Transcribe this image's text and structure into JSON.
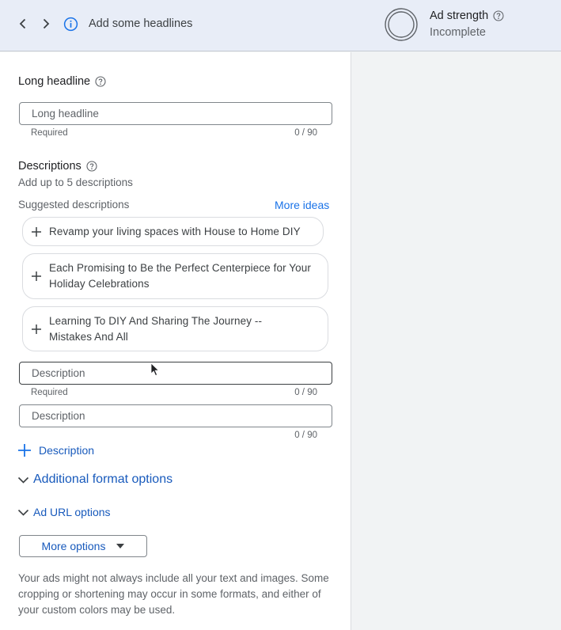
{
  "topbar": {
    "title": "Add some headlines",
    "back_icon": "chevron-left-icon",
    "forward_icon": "chevron-right-icon",
    "info_icon": "info-icon",
    "ad_strength_label": "Ad strength",
    "ad_strength_status": "Incomplete",
    "ring_color": "#5f6368"
  },
  "long_headline": {
    "label": "Long headline",
    "placeholder": "Long headline",
    "value": "",
    "hint": "Required",
    "count": "0 / 90"
  },
  "descriptions": {
    "label": "Descriptions",
    "subtitle": "Add up to 5 descriptions",
    "suggested_label": "Suggested descriptions",
    "more_ideas": "More ideas",
    "suggestions": [
      "Revamp your living spaces with House to Home DIY",
      "Each Promising to Be the Perfect Centerpiece for Your Holiday Celebrations",
      "Learning To DIY And Sharing The Journey -- Mistakes And All"
    ],
    "fields": [
      {
        "placeholder": "Description",
        "value": "",
        "hint": "Required",
        "count": "0 / 90"
      },
      {
        "placeholder": "Description",
        "value": "",
        "hint": "",
        "count": "0 / 90"
      }
    ],
    "add_label": "Description"
  },
  "additional_format_options": "Additional format options",
  "ad_url_options": "Ad URL options",
  "more_options": "More options",
  "disclaimer": "Your ads might not always include all your text and images. Some cropping or shortening may occur in some formats, and either of your custom colors may be used.",
  "colors": {
    "accent": "#1a73e8",
    "link": "#185abc",
    "topbar": "#e8edf7"
  }
}
